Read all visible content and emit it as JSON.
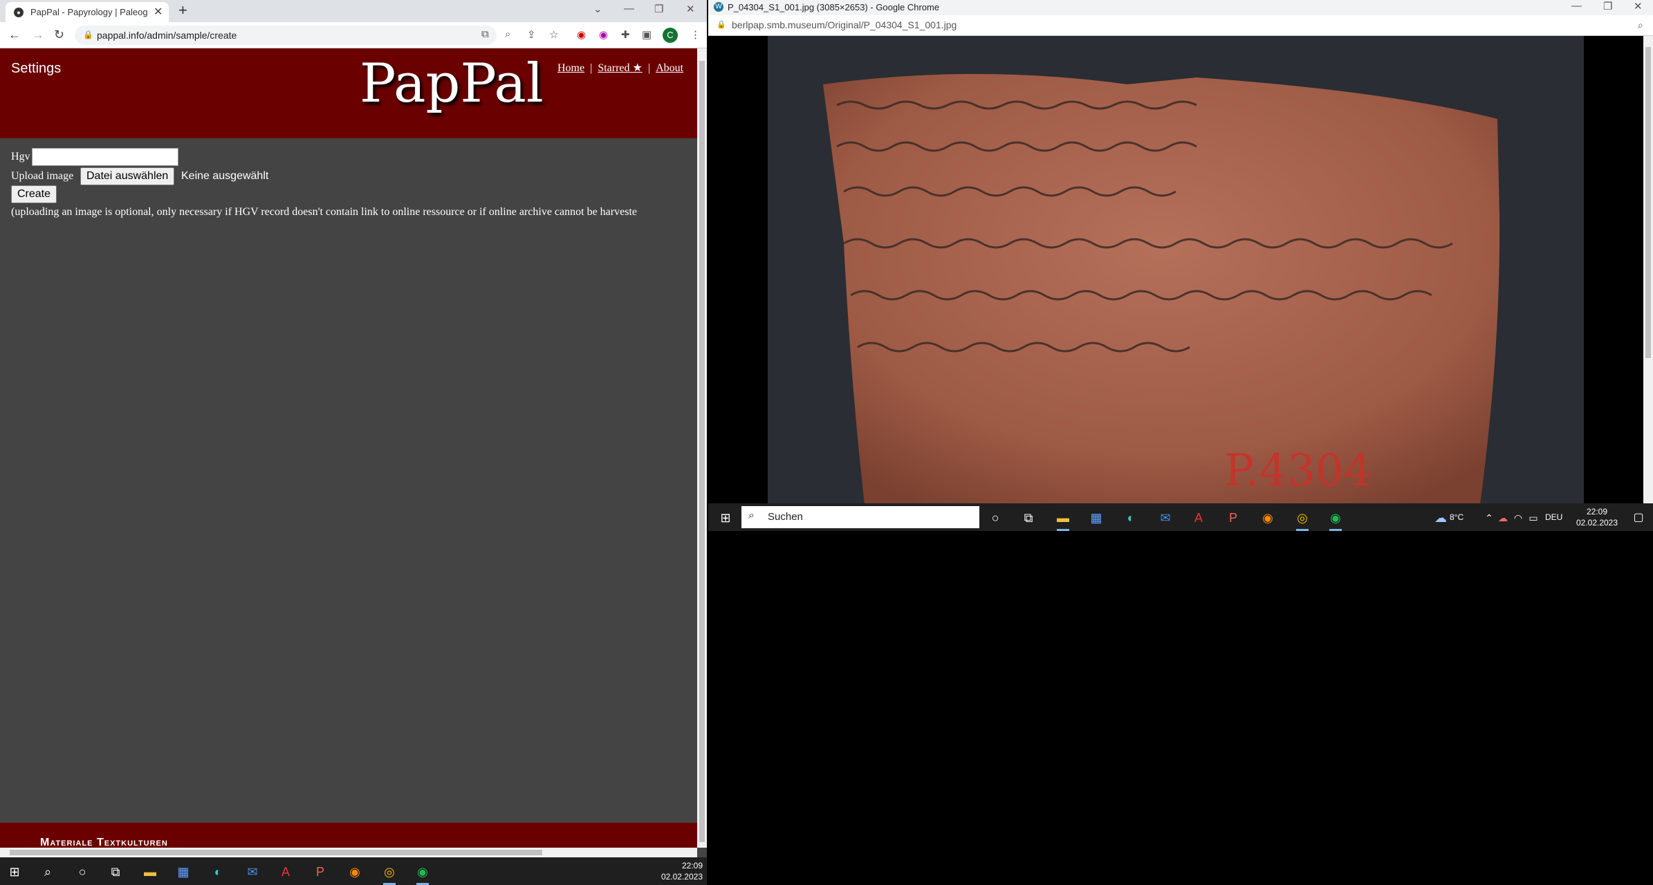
{
  "left_browser": {
    "tab_title": "PapPal - Papyrology | Paleograph",
    "url": "pappal.info/admin/sample/create",
    "profile_initial": "C"
  },
  "site": {
    "settings": "Settings",
    "logo": "PapPal",
    "nav": {
      "home": "Home",
      "starred": "Starred ★",
      "about": "About"
    },
    "sep": "|",
    "form": {
      "hgv_label": "Hgv",
      "hgv_value": "",
      "upload_label": "Upload image",
      "file_button": "Datei auswählen",
      "file_status": "Keine ausgewählt",
      "create_button": "Create",
      "note": "(uploading an image is optional, only necessary if HGV record doesn't contain link to online ressource or if online archive cannot be harveste"
    },
    "footer_brand": "Materiale Textkulturen"
  },
  "right_browser": {
    "title": "P_04304_S1_001.jpg (3085×2653) - Google Chrome",
    "url": "berlpap.smb.museum/Original/P_04304_S1_001.jpg",
    "stamp": "P.4304"
  },
  "taskbar_left": {
    "time": "22:09",
    "date": "02.02.2023"
  },
  "taskbar_right": {
    "search_placeholder": "Suchen",
    "weather": "8°C",
    "lang": "DEU",
    "time": "22:09",
    "date": "02.02.2023"
  }
}
